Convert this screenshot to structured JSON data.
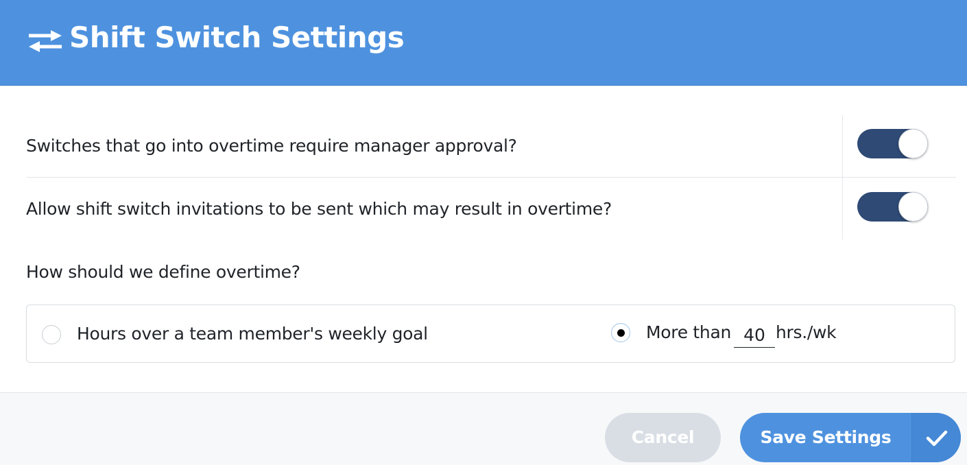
{
  "header": {
    "icon": "swap-arrows-icon",
    "title": "Shift Switch Settings"
  },
  "settings": {
    "overtime_approval": {
      "label": "Switches that go into overtime require manager approval?",
      "enabled": true
    },
    "allow_overtime_invites": {
      "label": "Allow shift switch invitations to be sent which may result in overtime?",
      "enabled": true
    }
  },
  "overtime_definition": {
    "question": "How should we define overtime?",
    "options": [
      {
        "label": "Hours over a team member's weekly goal",
        "selected": false
      },
      {
        "label_prefix": "More than",
        "hours_value": "40",
        "label_suffix": "hrs./wk",
        "selected": true
      }
    ]
  },
  "footer": {
    "cancel_label": "Cancel",
    "save_label": "Save Settings",
    "save_icon": "checkmark-icon"
  },
  "colors": {
    "header_blue": "#4e92df",
    "toggle_on": "#2e4a75",
    "cancel_disabled": "#d9dee5",
    "footer_bg": "#f7f8fa"
  }
}
